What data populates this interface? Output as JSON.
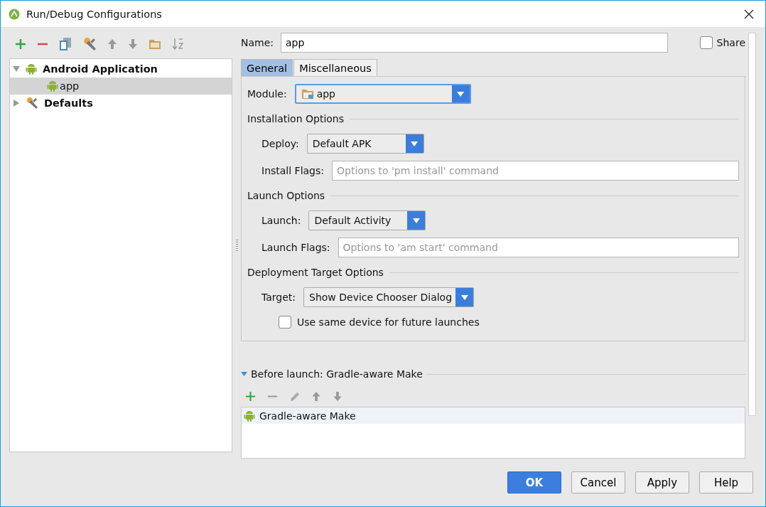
{
  "window": {
    "title": "Run/Debug Configurations"
  },
  "tree": [
    {
      "label": "Android Application",
      "kind": "android",
      "expanded": true,
      "selected": false,
      "children": [
        {
          "label": "app",
          "kind": "android",
          "selected": true
        }
      ]
    },
    {
      "label": "Defaults",
      "kind": "wrench",
      "expanded": false,
      "selected": false
    }
  ],
  "name_field": {
    "label": "Name:",
    "value": "app"
  },
  "share": {
    "label": "Share",
    "checked": false
  },
  "tabs": [
    {
      "label": "General",
      "selected": true
    },
    {
      "label": "Miscellaneous",
      "selected": false
    }
  ],
  "module": {
    "label": "Module:",
    "value": "app"
  },
  "sections": [
    {
      "title": "Installation Options",
      "rows": [
        {
          "kind": "dropdown",
          "label": "Deploy:",
          "value": "Default APK"
        },
        {
          "kind": "field",
          "label": "Install Flags:",
          "placeholder": "Options to 'pm install' command"
        }
      ]
    },
    {
      "title": "Launch Options",
      "rows": [
        {
          "kind": "dropdown",
          "label": "Launch:",
          "value": "Default Activity"
        },
        {
          "kind": "field",
          "label": "Launch Flags:",
          "placeholder": "Options to 'am start' command"
        }
      ]
    },
    {
      "title": "Deployment Target Options",
      "rows": [
        {
          "kind": "dropdown",
          "label": "Target:",
          "value": "Show Device Chooser Dialog"
        },
        {
          "kind": "checkbox",
          "label": "Use same device for future launches",
          "checked": false
        }
      ]
    }
  ],
  "before_launch": {
    "title": "Before launch: Gradle-aware Make",
    "expanded": true,
    "tasks": [
      {
        "label": "Gradle-aware Make",
        "selected": true
      }
    ]
  },
  "buttons": [
    {
      "label": "OK",
      "primary": true
    },
    {
      "label": "Cancel",
      "primary": false
    },
    {
      "label": "Apply",
      "primary": false
    },
    {
      "label": "Help",
      "primary": false
    }
  ]
}
